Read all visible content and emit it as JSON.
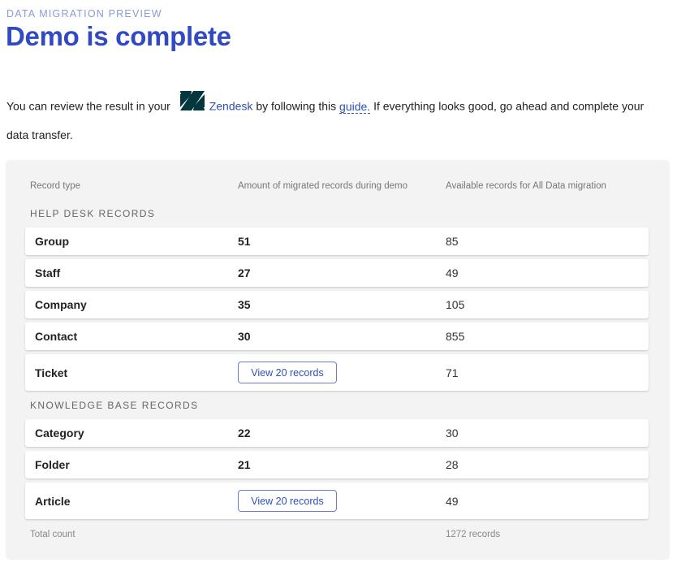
{
  "header": {
    "eyebrow": "DATA MIGRATION PREVIEW",
    "title": "Demo is complete"
  },
  "intro": {
    "text_before": "You can review the result in your",
    "platform_name": "Zendesk",
    "text_middle": "by following this",
    "guide_link": "guide.",
    "text_after": "If everything looks good, go ahead and complete your data transfer."
  },
  "table": {
    "columns": [
      "Record type",
      "Amount of migrated records during demo",
      "Available records for All Data migration"
    ],
    "sections": [
      {
        "label": "HELP DESK RECORDS",
        "rows": [
          {
            "type": "Group",
            "migrated": "51",
            "available": "85"
          },
          {
            "type": "Staff",
            "migrated": "27",
            "available": "49"
          },
          {
            "type": "Company",
            "migrated": "35",
            "available": "105"
          },
          {
            "type": "Contact",
            "migrated": "30",
            "available": "855"
          },
          {
            "type": "Ticket",
            "migrated_button": "View 20 records",
            "available": "71"
          }
        ]
      },
      {
        "label": "KNOWLEDGE BASE RECORDS",
        "rows": [
          {
            "type": "Category",
            "migrated": "22",
            "available": "30"
          },
          {
            "type": "Folder",
            "migrated": "21",
            "available": "28"
          },
          {
            "type": "Article",
            "migrated_button": "View 20 records",
            "available": "49"
          }
        ]
      }
    ],
    "total_label": "Total count",
    "total_value": "1272 records"
  },
  "colors": {
    "accent": "#3249c4",
    "eyebrow": "#8a9ad8",
    "link": "#2f4fb5",
    "panel_bg": "#f3f3f3",
    "zendesk_logo": "#03363d"
  },
  "icons": {
    "platform_logo": "zendesk-logo-icon"
  }
}
